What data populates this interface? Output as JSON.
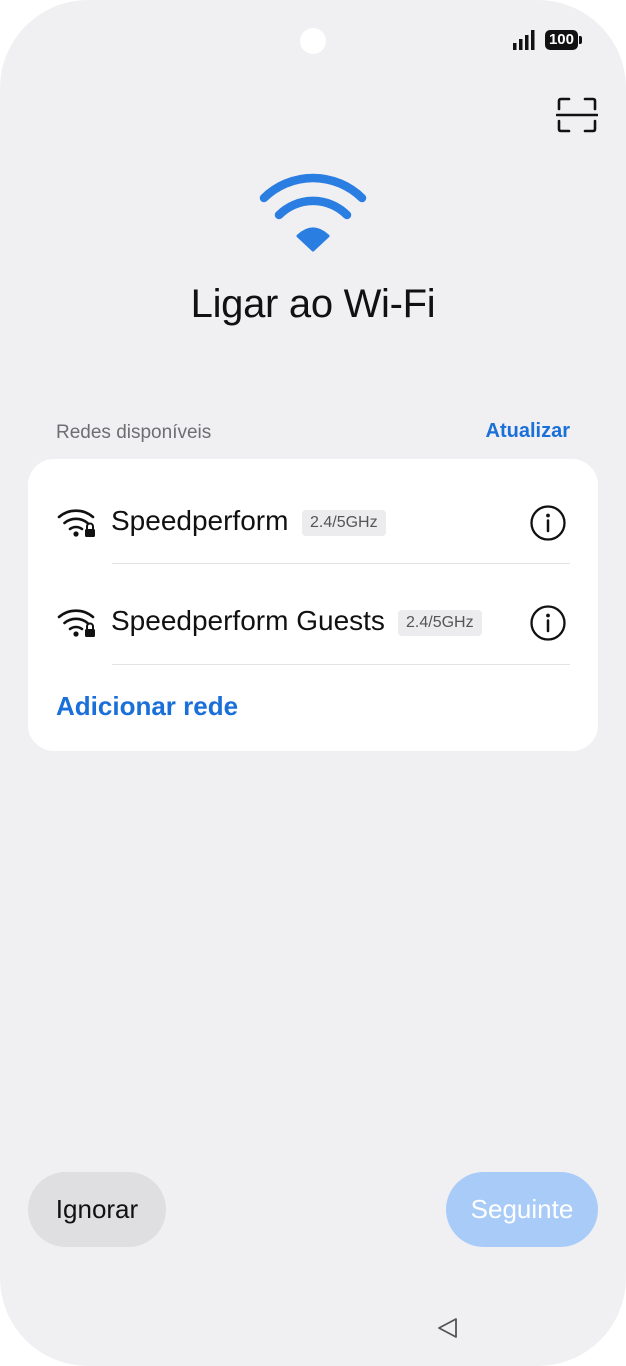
{
  "status_bar": {
    "battery": "100"
  },
  "header": {
    "title": "Ligar ao Wi-Fi"
  },
  "networks_section": {
    "label": "Redes disponíveis",
    "refresh_label": "Atualizar",
    "networks": [
      {
        "name": "Speedperform",
        "band": "2.4/5GHz"
      },
      {
        "name": "Speedperform Guests",
        "band": "2.4/5GHz"
      }
    ],
    "add_network_label": "Adicionar rede"
  },
  "footer": {
    "ignore_label": "Ignorar",
    "next_label": "Seguinte"
  },
  "colors": {
    "accent": "#1a6fd8",
    "wifi_hero": "#2a7de1",
    "next_disabled": "#a9cbf8",
    "background": "#f0f0f3"
  },
  "icons": {
    "scan": "qr-scan-icon",
    "hero": "wifi-icon",
    "network": "wifi-lock-icon",
    "info": "info-icon",
    "back": "nav-back-icon"
  }
}
